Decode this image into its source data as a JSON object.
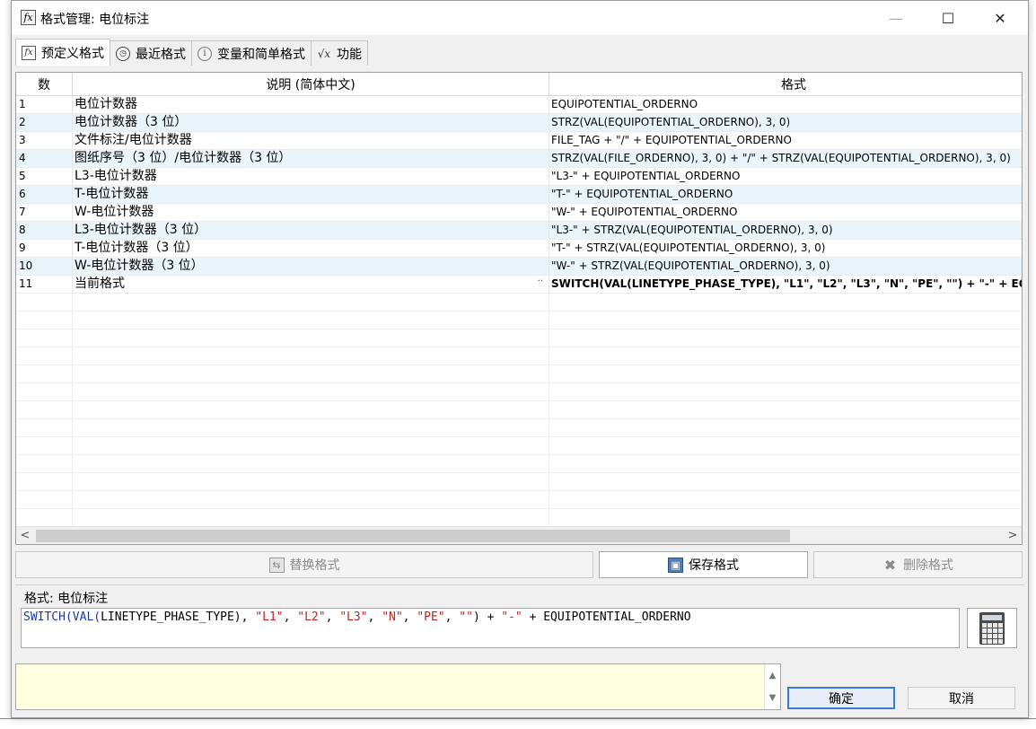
{
  "window": {
    "title": "格式管理: 电位标注",
    "minimize_glyph": "—",
    "maximize_glyph": "☐",
    "close_glyph": "✕"
  },
  "tabs": [
    {
      "label": "预定义格式",
      "icon": "fx-icon",
      "active": true
    },
    {
      "label": "最近格式",
      "icon": "clock-icon",
      "active": false
    },
    {
      "label": "变量和简单格式",
      "icon": "info-icon",
      "active": false
    },
    {
      "label": "功能",
      "icon": "sqrt-function-icon",
      "active": false
    }
  ],
  "tab_icons": {
    "fx": "fx",
    "clock": "◷",
    "info": "i",
    "sqrt": "√x"
  },
  "grid": {
    "columns": [
      "数",
      "说明 (简体中文)",
      "格式"
    ],
    "rows": [
      {
        "n": "1",
        "desc": "电位计数器",
        "fmt": "EQUIPOTENTIAL_ORDERNO"
      },
      {
        "n": "2",
        "desc": "电位计数器（3 位）",
        "fmt": "STRZ(VAL(EQUIPOTENTIAL_ORDERNO), 3, 0)"
      },
      {
        "n": "3",
        "desc": "文件标注/电位计数器",
        "fmt": "FILE_TAG + \"/\" + EQUIPOTENTIAL_ORDERNO"
      },
      {
        "n": "4",
        "desc": "图纸序号（3 位）/电位计数器（3 位）",
        "fmt": "STRZ(VAL(FILE_ORDERNO), 3, 0) + \"/\" + STRZ(VAL(EQUIPOTENTIAL_ORDERNO), 3, 0)"
      },
      {
        "n": "5",
        "desc": "L3-电位计数器",
        "fmt": "\"L3-\" + EQUIPOTENTIAL_ORDERNO"
      },
      {
        "n": "6",
        "desc": "T-电位计数器",
        "fmt": "\"T-\" + EQUIPOTENTIAL_ORDERNO"
      },
      {
        "n": "7",
        "desc": "W-电位计数器",
        "fmt": "\"W-\" + EQUIPOTENTIAL_ORDERNO"
      },
      {
        "n": "8",
        "desc": "L3-电位计数器（3 位）",
        "fmt": "\"L3-\" + STRZ(VAL(EQUIPOTENTIAL_ORDERNO), 3, 0)"
      },
      {
        "n": "9",
        "desc": "T-电位计数器（3 位）",
        "fmt": "\"T-\" + STRZ(VAL(EQUIPOTENTIAL_ORDERNO), 3, 0)"
      },
      {
        "n": "10",
        "desc": "W-电位计数器（3 位）",
        "fmt": "\"W-\" + STRZ(VAL(EQUIPOTENTIAL_ORDERNO), 3, 0)"
      },
      {
        "n": "11",
        "desc": "当前格式",
        "fmt": "SWITCH(VAL(LINETYPE_PHASE_TYPE), \"L1\", \"L2\", \"L3\", \"N\", \"PE\", \"\") + \"-\" + EQUIPOTENTIAL_ORDERNO",
        "bold": true,
        "dots": "··"
      }
    ],
    "scroll_left": "<",
    "scroll_right": ">"
  },
  "buttons": {
    "replace": "替换格式",
    "save": "保存格式",
    "delete": "删除格式",
    "ok": "确定",
    "cancel": "取消"
  },
  "button_icons": {
    "replace": "⇆",
    "save": "▣",
    "delete": "✖"
  },
  "formula": {
    "label": "格式: 电位标注",
    "tokens": [
      {
        "t": "SWITCH(VAL(",
        "k": "kw"
      },
      {
        "t": "LINETYPE_PHASE_TYPE), ",
        "k": "plain"
      },
      {
        "t": "\"L1\"",
        "k": "str"
      },
      {
        "t": ", ",
        "k": "plain"
      },
      {
        "t": "\"L2\"",
        "k": "str"
      },
      {
        "t": ", ",
        "k": "plain"
      },
      {
        "t": "\"L3\"",
        "k": "str"
      },
      {
        "t": ", ",
        "k": "plain"
      },
      {
        "t": "\"N\"",
        "k": "str"
      },
      {
        "t": ", ",
        "k": "plain"
      },
      {
        "t": "\"PE\"",
        "k": "str"
      },
      {
        "t": ", ",
        "k": "plain"
      },
      {
        "t": "\"\"",
        "k": "str"
      },
      {
        "t": ") + ",
        "k": "plain"
      },
      {
        "t": "\"-\"",
        "k": "str"
      },
      {
        "t": " + EQUIPOTENTIAL_ORDERNO",
        "k": "plain"
      }
    ]
  },
  "message_scroll": {
    "up": "▲",
    "down": "▼"
  },
  "colors": {
    "row_alt": "#eaf5fb",
    "editor_keyword": "#1b3aa8",
    "editor_string": "#c0241e",
    "message_bg": "#ffffe1",
    "ok_border": "#3b7ad6"
  }
}
